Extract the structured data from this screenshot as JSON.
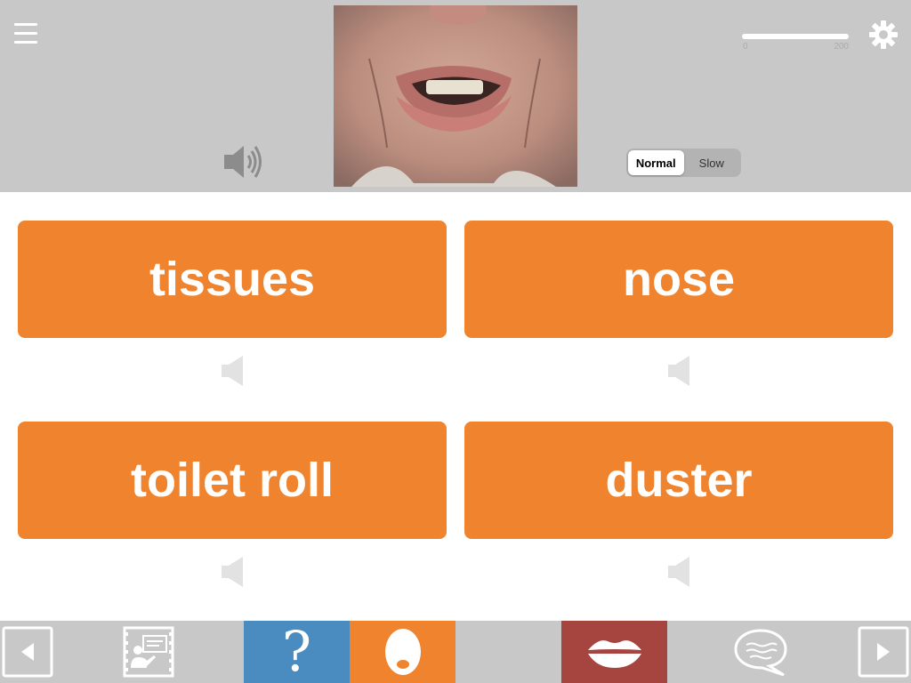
{
  "speed": {
    "options": [
      "Normal",
      "Slow"
    ],
    "selected": "Normal"
  },
  "volume": {
    "min": "0",
    "max": "200"
  },
  "answers": [
    {
      "label": "tissues"
    },
    {
      "label": "nose"
    },
    {
      "label": "toilet roll"
    },
    {
      "label": "duster"
    }
  ],
  "toolbar": {
    "question_mark": "?",
    "tile_colors": {
      "question": "#4a8cc0",
      "mouth": "#ef832e",
      "lips": "#a64540"
    }
  },
  "colors": {
    "accent": "#ef832e",
    "bar_gray": "#c8c8c8"
  }
}
